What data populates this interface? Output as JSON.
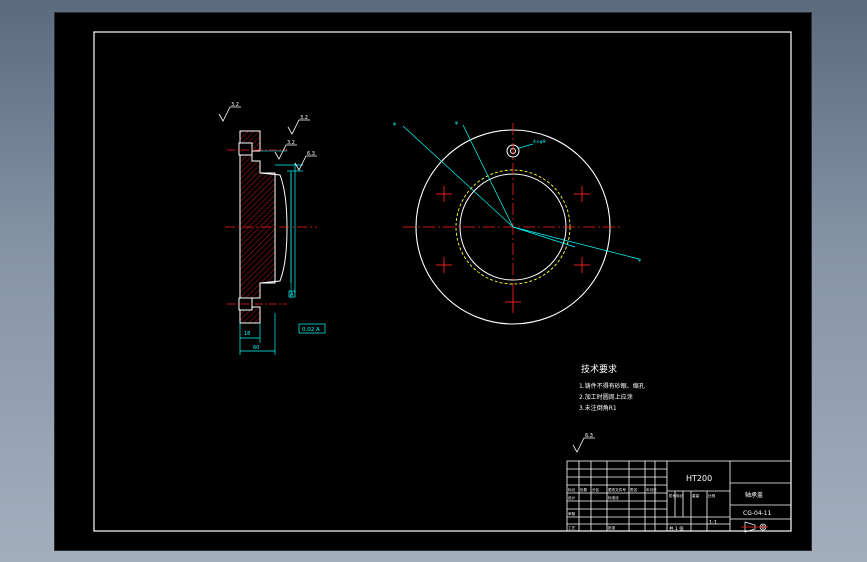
{
  "tech_requirements": {
    "title": "技术要求",
    "items": [
      "1.铸件不得有砂眼、缩孔",
      "2.加工时圆周上应涂",
      "3.未注倒角R1"
    ]
  },
  "roughness": {
    "r1": "3.2",
    "r2": "3.2",
    "r3": "3.2",
    "r4": "6.3",
    "general": "6.3"
  },
  "dims": {
    "flatness": "0.02 A",
    "datum": "A",
    "left_width": "18",
    "bottom_width": "60"
  },
  "leaders": {
    "l1": "φ",
    "l2": "φ",
    "l3": "4×φ9",
    "l4": "φ"
  },
  "title_block": {
    "material": "HT200",
    "part_name": "轴承盖",
    "drawing_no": "CG-04-11",
    "scale": "1:1",
    "sheet": "共 1 张",
    "row_labels": [
      "标记",
      "处数",
      "分区",
      "更改文件号",
      "签名",
      "年月日"
    ],
    "left_labels": [
      "设计",
      "审核",
      "工艺"
    ],
    "mid_labels": [
      "标准化",
      "批准"
    ],
    "stage_label": "阶段标记",
    "weight_label": "重量",
    "ratio_label": "比例"
  },
  "colors": {
    "white": "#ffffff",
    "cyan": "#00ffff",
    "red": "#ff2020",
    "yellow": "#ffff33",
    "bg": "#000000"
  }
}
